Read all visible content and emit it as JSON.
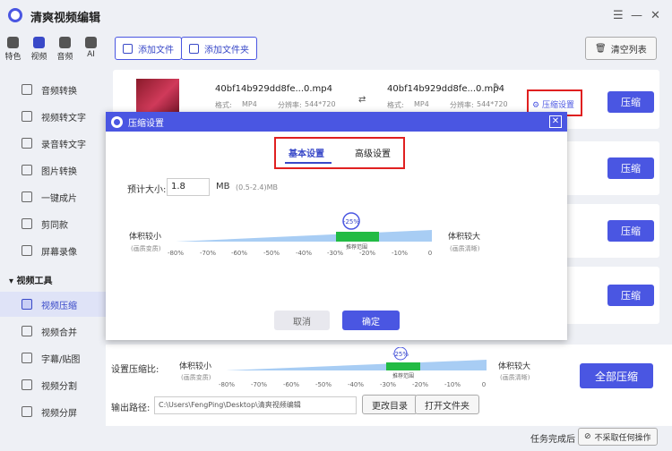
{
  "app": {
    "title": "清爽视频编辑",
    "controls": [
      "☰",
      "—",
      "□",
      "✕"
    ]
  },
  "topnav": [
    {
      "label": "特色"
    },
    {
      "label": "视频"
    },
    {
      "label": "音频"
    },
    {
      "label": "AI"
    }
  ],
  "sidebar": {
    "items": [
      "音频转换",
      "视频转文字",
      "录音转文字",
      "图片转换",
      "一键成片",
      "剪同款",
      "屏幕录像"
    ],
    "section": "视频工具",
    "tools": [
      "视频压缩",
      "视频合并",
      "字幕/贴图",
      "视频分割",
      "视频分屏"
    ]
  },
  "toolbar": {
    "add_file": "添加文件",
    "add_folder": "添加文件夹",
    "clear": "清空列表"
  },
  "file": {
    "src_name": "40bf14b929dd8fe...0.mp4",
    "dst_name": "40bf14b929dd8fe...0.mp4",
    "format_label": "格式:",
    "format": "MP4",
    "res_label": "分辨率:",
    "res": "544*720",
    "setting": "压缩设置",
    "compress": "压缩"
  },
  "row_buttons": [
    "压缩",
    "压缩",
    "压缩",
    "压缩"
  ],
  "dialog": {
    "title": "压缩设置",
    "close": "✕",
    "tab_basic": "基本设置",
    "tab_advanced": "高级设置",
    "est_label": "预计大小:",
    "est_value": "1.8",
    "est_unit": "MB",
    "est_range": "(0.5-2.4)MB",
    "small_label": "体积较小",
    "small_sub": "(画质变质)",
    "large_label": "体积较大",
    "large_sub": "(画质清晰)",
    "marker": "-25%",
    "recommend": "推荐范围",
    "ticks": [
      "-80%",
      "-70%",
      "-60%",
      "-50%",
      "-40%",
      "-30%",
      "-20%",
      "-10%",
      "0"
    ],
    "cancel": "取消",
    "ok": "确定"
  },
  "bottom": {
    "ratio_label": "设置压缩比:",
    "small_label": "体积较小",
    "small_sub": "(画质变质)",
    "large_label": "体积较大",
    "large_sub": "(画质清晰)",
    "marker": "-25%",
    "recommend": "推荐范围",
    "ticks": [
      "-80%",
      "-70%",
      "-60%",
      "-50%",
      "-40%",
      "-30%",
      "-20%",
      "-10%",
      "0"
    ],
    "all": "全部压缩",
    "path_label": "输出路径:",
    "path": "C:\\Users\\FengPing\\Desktop\\清爽视频编辑",
    "change_dir": "更改目录",
    "open_folder": "打开文件夹"
  },
  "status": {
    "done_label": "任务完成后",
    "action": "不采取任何操作"
  },
  "colors": {
    "accent": "#4a56e2",
    "highlight": "#e02020",
    "green": "#22bb44"
  }
}
